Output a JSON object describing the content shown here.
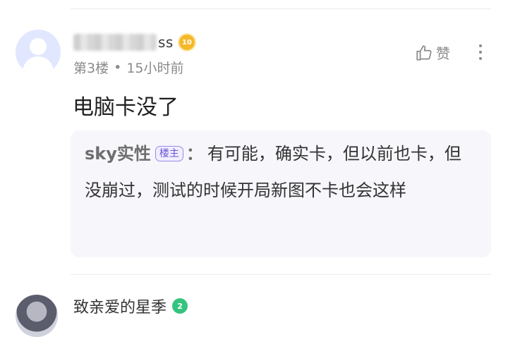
{
  "comment": {
    "username_visible": "ss",
    "level": "10",
    "floor": "第3楼",
    "time": "15小时前",
    "like_label": "赞",
    "text": "电脑卡没了"
  },
  "reply": {
    "author": "sky实性",
    "badge": "楼主",
    "colon": "：",
    "text": "有可能，确实卡，但以前也卡，但没崩过，测试的时候开局新图不卡也会这样"
  },
  "next_comment": {
    "username": "致亲爱的星季",
    "level": "2"
  },
  "colors": {
    "accent_purple": "#6a54d6",
    "level_gold": "#f5b82b",
    "level_green": "#35c47f",
    "reply_bg": "#f6f6fb"
  },
  "icons": [
    "thumb-up-icon",
    "more-vertical-icon",
    "level-badge-icon"
  ]
}
